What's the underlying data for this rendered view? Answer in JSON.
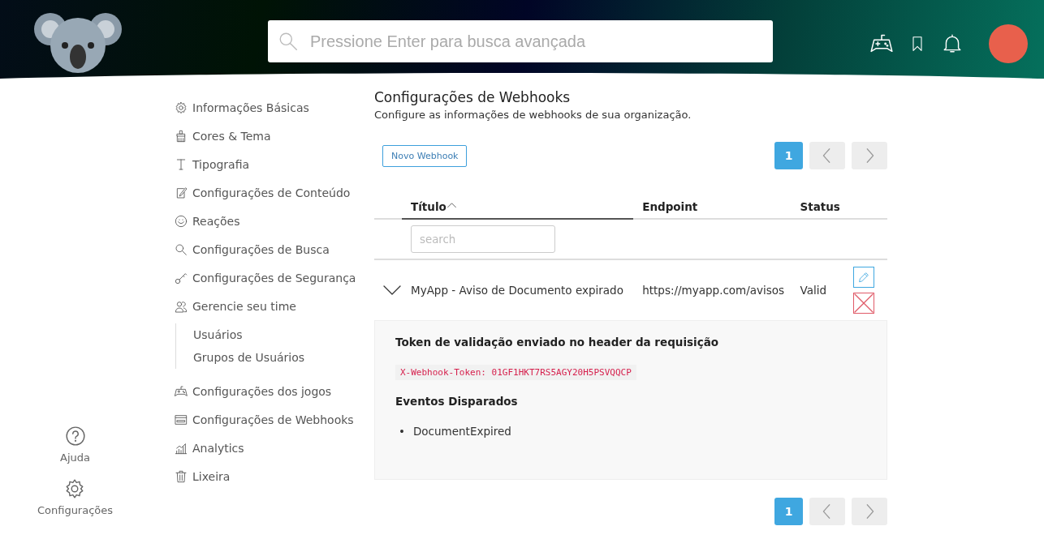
{
  "header": {
    "search": {
      "placeholder": "Pressione Enter para busca avançada"
    }
  },
  "rail": [
    {
      "kind": "help",
      "label": "Ajuda"
    },
    {
      "kind": "gear",
      "label": "Configurações"
    }
  ],
  "settings_nav": [
    {
      "kind": "gear",
      "label": "Informações Básicas"
    },
    {
      "kind": "brush",
      "label": "Cores & Tema"
    },
    {
      "kind": "type",
      "label": "Tipografia"
    },
    {
      "kind": "note",
      "label": "Configurações de Conteúdo"
    },
    {
      "kind": "smile",
      "label": "Reações"
    },
    {
      "kind": "search",
      "label": "Configurações de Busca"
    },
    {
      "kind": "key",
      "label": "Configurações de Segurança"
    },
    {
      "kind": "people",
      "label": "Gerencie seu time",
      "children": [
        {
          "label": "Usuários"
        },
        {
          "label": "Grupos de Usuários"
        }
      ]
    },
    {
      "kind": "gamepad",
      "label": "Configurações dos jogos"
    },
    {
      "kind": "window",
      "label": "Configurações de Webhooks"
    },
    {
      "kind": "chart",
      "label": "Analytics"
    },
    {
      "kind": "trash",
      "label": "Lixeira"
    }
  ],
  "page": {
    "title": "Configurações de Webhooks",
    "subtitle": "Configure as informações de webhooks de sua organização."
  },
  "new_button": "Novo Webhook",
  "pagination_top": {
    "pages": [
      {
        "label": "1",
        "selected": true
      }
    ]
  },
  "table": {
    "columns": [
      {
        "label": "Título",
        "sorted": true
      },
      {
        "label": "Endpoint",
        "sorted": false
      },
      {
        "label": "Status",
        "sorted": false
      }
    ],
    "filter": {
      "placeholder": "search"
    },
    "rows": [
      {
        "expanded": true,
        "title": "MyApp - Aviso de Documento expirado",
        "endpoint": "https://myapp.com/avisos",
        "status": "Valid",
        "details": {
          "token_heading": "Token de validação enviado no header da requisição",
          "token": "X-Webhook-Token: 01GF1HKT7RS5AGY20H5PSVQQCP",
          "events_heading": "Eventos Disparados",
          "events": [
            {
              "bullet": "•",
              "label": "DocumentExpired"
            }
          ]
        }
      }
    ]
  },
  "pagination_bottom": {
    "pages": [
      {
        "label": "1",
        "selected": true
      }
    ]
  }
}
